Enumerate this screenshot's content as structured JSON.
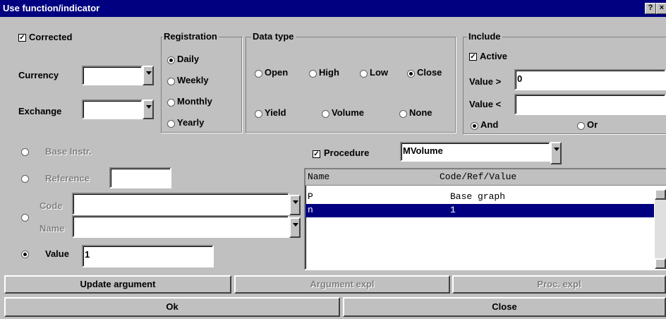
{
  "window": {
    "title": "Use function/indicator",
    "help_label": "?",
    "close_label": "×"
  },
  "corrected": {
    "label": "Corrected",
    "checked": true
  },
  "currency": {
    "label": "Currency",
    "value": ""
  },
  "exchange": {
    "label": "Exchange",
    "value": ""
  },
  "registration": {
    "title": "Registration",
    "options": [
      "Daily",
      "Weekly",
      "Monthly",
      "Yearly"
    ],
    "selected": "Daily"
  },
  "data_type": {
    "title": "Data type",
    "row1": [
      "Open",
      "High",
      "Low",
      "Close"
    ],
    "row2": [
      "Yield",
      "Volume",
      "None"
    ],
    "selected": "Close"
  },
  "include": {
    "title": "Include",
    "active_label": "Active",
    "active_checked": true,
    "value_gt_label": "Value >",
    "value_gt": "0",
    "value_lt_label": "Value <",
    "value_lt": "",
    "and_label": "And",
    "or_label": "Or",
    "selected": "And"
  },
  "argument": {
    "base_instr_label": "Base Instr.",
    "reference_label": "Reference",
    "reference_value": "",
    "code_label": "Code",
    "name_label": "Name",
    "value_label": "Value",
    "value": "1",
    "selected": "Value"
  },
  "procedure": {
    "label": "Procedure",
    "checked": true,
    "value": "MVolume"
  },
  "table": {
    "headers": [
      "Name",
      "Code/Ref/Value"
    ],
    "rows": [
      {
        "name": "P",
        "value": "Base graph",
        "selected": false
      },
      {
        "name": "n",
        "value": "1",
        "selected": true
      }
    ]
  },
  "buttons": {
    "update": "Update argument",
    "arg_expl": "Argument expl",
    "proc_expl": "Proc. expl",
    "ok": "Ok",
    "close": "Close"
  },
  "colors": {
    "title_bg": "#000080",
    "face": "#c0c0c0",
    "selection": "#000080"
  }
}
